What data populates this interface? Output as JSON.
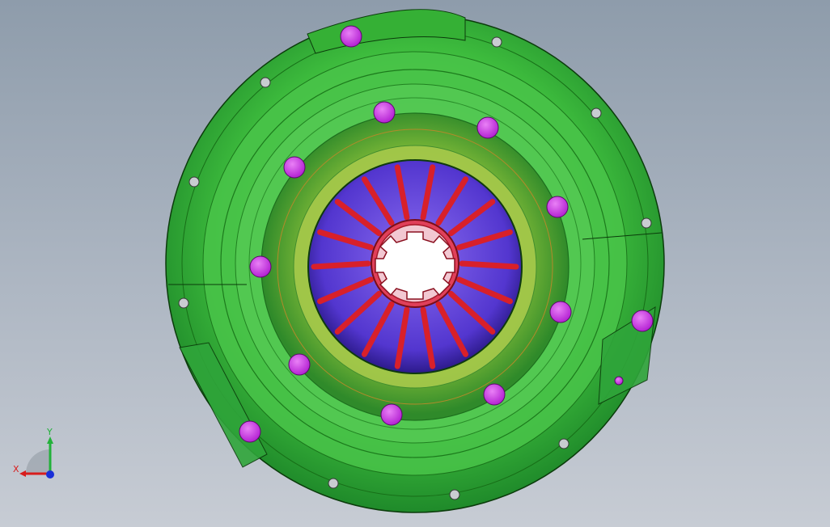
{
  "viewport": {
    "background_top": "#8e9cab",
    "background_bottom": "#c7ccd4"
  },
  "model": {
    "flange_color": "#3dbb3d",
    "inner_ring_color": "#5fae2e",
    "hub_color": "#5b39d6",
    "spring_color": "#d8202a",
    "bolt_color": "#c728e0",
    "hole_color": "#c9ccd1",
    "outline_color": "#0b3b0b"
  },
  "triad": {
    "x_label": "X",
    "y_label": "Y",
    "x_color": "#d81d1d",
    "y_color": "#22b13a",
    "z_color": "#1a2fd8"
  }
}
